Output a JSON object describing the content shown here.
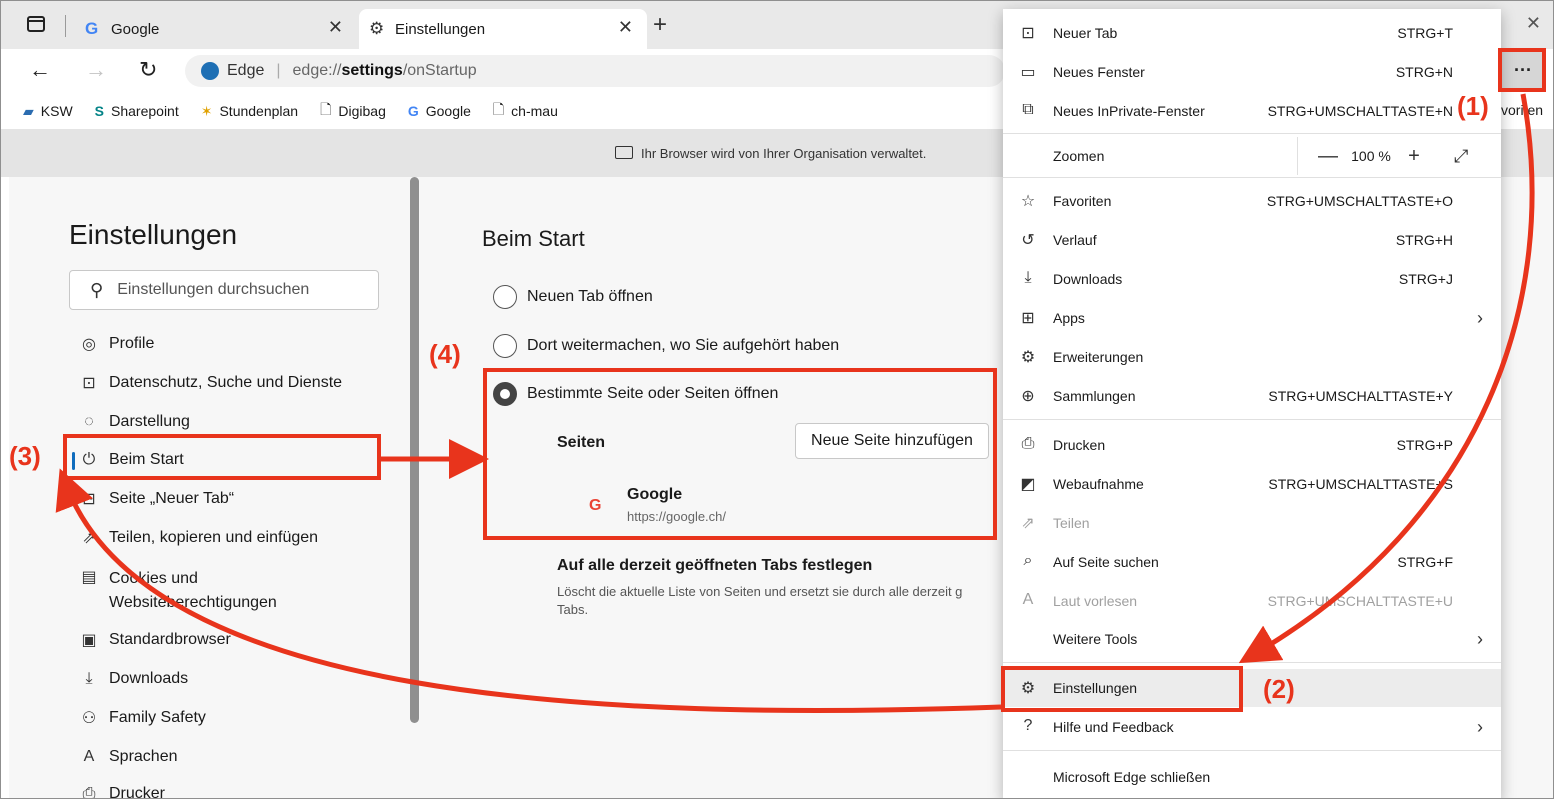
{
  "tabs": [
    {
      "label": "Google",
      "icon": "google-favicon"
    },
    {
      "label": "Einstellungen",
      "icon": "gear-icon"
    }
  ],
  "address": {
    "browser_label": "Edge",
    "url_prefix": "edge://",
    "url_bold": "settings",
    "url_suffix": "/onStartup"
  },
  "favorites": [
    {
      "label": "KSW",
      "icon": "ksw-icon"
    },
    {
      "label": "Sharepoint",
      "icon": "sharepoint-icon"
    },
    {
      "label": "Stundenplan",
      "icon": "stundenplan-icon"
    },
    {
      "label": "Digibag",
      "icon": "page-icon"
    },
    {
      "label": "Google",
      "icon": "google-favicon"
    },
    {
      "label": "ch-mau",
      "icon": "page-icon"
    }
  ],
  "favorites_overflow": "voriten",
  "banner": "Ihr Browser wird von Ihrer Organisation verwaltet.",
  "sidebar": {
    "title": "Einstellungen",
    "search_placeholder": "Einstellungen durchsuchen",
    "items": [
      {
        "label": "Profile",
        "icon": "profile-icon"
      },
      {
        "label": "Datenschutz, Suche und Dienste",
        "icon": "lock-icon"
      },
      {
        "label": "Darstellung",
        "icon": "palette-icon"
      },
      {
        "label": "Beim Start",
        "icon": "power-icon",
        "active": true
      },
      {
        "label": "Seite „Neuer Tab“",
        "icon": "newtab-icon"
      },
      {
        "label": "Teilen, kopieren und einfügen",
        "icon": "share-icon"
      },
      {
        "label": "Cookies und",
        "label2": "Websiteberechtigungen",
        "icon": "cookies-icon"
      },
      {
        "label": "Standardbrowser",
        "icon": "browser-icon"
      },
      {
        "label": "Downloads",
        "icon": "download-icon"
      },
      {
        "label": "Family Safety",
        "icon": "family-icon"
      },
      {
        "label": "Sprachen",
        "icon": "language-icon"
      },
      {
        "label": "Drucker",
        "icon": "printer-icon"
      }
    ]
  },
  "main": {
    "title": "Beim Start",
    "options": [
      {
        "label": "Neuen Tab öffnen",
        "checked": false
      },
      {
        "label": "Dort weitermachen, wo Sie aufgehört haben",
        "checked": false
      },
      {
        "label": "Bestimmte Seite oder Seiten öffnen",
        "checked": true
      }
    ],
    "pages_label": "Seiten",
    "add_button": "Neue Seite hinzufügen",
    "page_entry": {
      "name": "Google",
      "url": "https://google.ch/"
    },
    "set_all_title": "Auf alle derzeit geöffneten Tabs festlegen",
    "set_all_desc": "Löscht die aktuelle Liste von Seiten und ersetzt sie durch alle derzeit g",
    "set_all_desc2": "Tabs."
  },
  "menu": {
    "items": [
      {
        "label": "Neuer Tab",
        "shortcut": "STRG+T",
        "icon": "newtab-icon"
      },
      {
        "label": "Neues Fenster",
        "shortcut": "STRG+N",
        "icon": "window-icon"
      },
      {
        "label": "Neues InPrivate-Fenster",
        "shortcut": "STRG+UMSCHALTTASTE+N",
        "icon": "inprivate-icon"
      },
      {
        "label": "Zoomen",
        "zoom": "100 %"
      },
      {
        "label": "Favoriten",
        "shortcut": "STRG+UMSCHALTTASTE+O",
        "icon": "favorites-icon"
      },
      {
        "label": "Verlauf",
        "shortcut": "STRG+H",
        "icon": "history-icon"
      },
      {
        "label": "Downloads",
        "shortcut": "STRG+J",
        "icon": "download-icon"
      },
      {
        "label": "Apps",
        "icon": "apps-icon",
        "submenu": true
      },
      {
        "label": "Erweiterungen",
        "icon": "extensions-icon"
      },
      {
        "label": "Sammlungen",
        "shortcut": "STRG+UMSCHALTTASTE+Y",
        "icon": "collections-icon"
      },
      {
        "label": "Drucken",
        "shortcut": "STRG+P",
        "icon": "printer-icon"
      },
      {
        "label": "Webaufnahme",
        "shortcut": "STRG+UMSCHALTTASTE+S",
        "icon": "webcapture-icon"
      },
      {
        "label": "Teilen",
        "icon": "share-icon",
        "disabled": true
      },
      {
        "label": "Auf Seite suchen",
        "shortcut": "STRG+F",
        "icon": "find-icon"
      },
      {
        "label": "Laut vorlesen",
        "shortcut": "STRG+UMSCHALTTASTE+U",
        "icon": "read-aloud-icon",
        "disabled": true
      },
      {
        "label": "Weitere Tools",
        "submenu": true
      },
      {
        "label": "Einstellungen",
        "icon": "gear-icon",
        "highlighted": true
      },
      {
        "label": "Hilfe und Feedback",
        "icon": "help-icon",
        "submenu": true
      },
      {
        "label": "Microsoft Edge schließen"
      }
    ]
  },
  "annotations": [
    "(1)",
    "(2)",
    "(3)",
    "(4)"
  ],
  "colors": {
    "annotation": "#e8341c",
    "active_accent": "#0f6cbd"
  }
}
